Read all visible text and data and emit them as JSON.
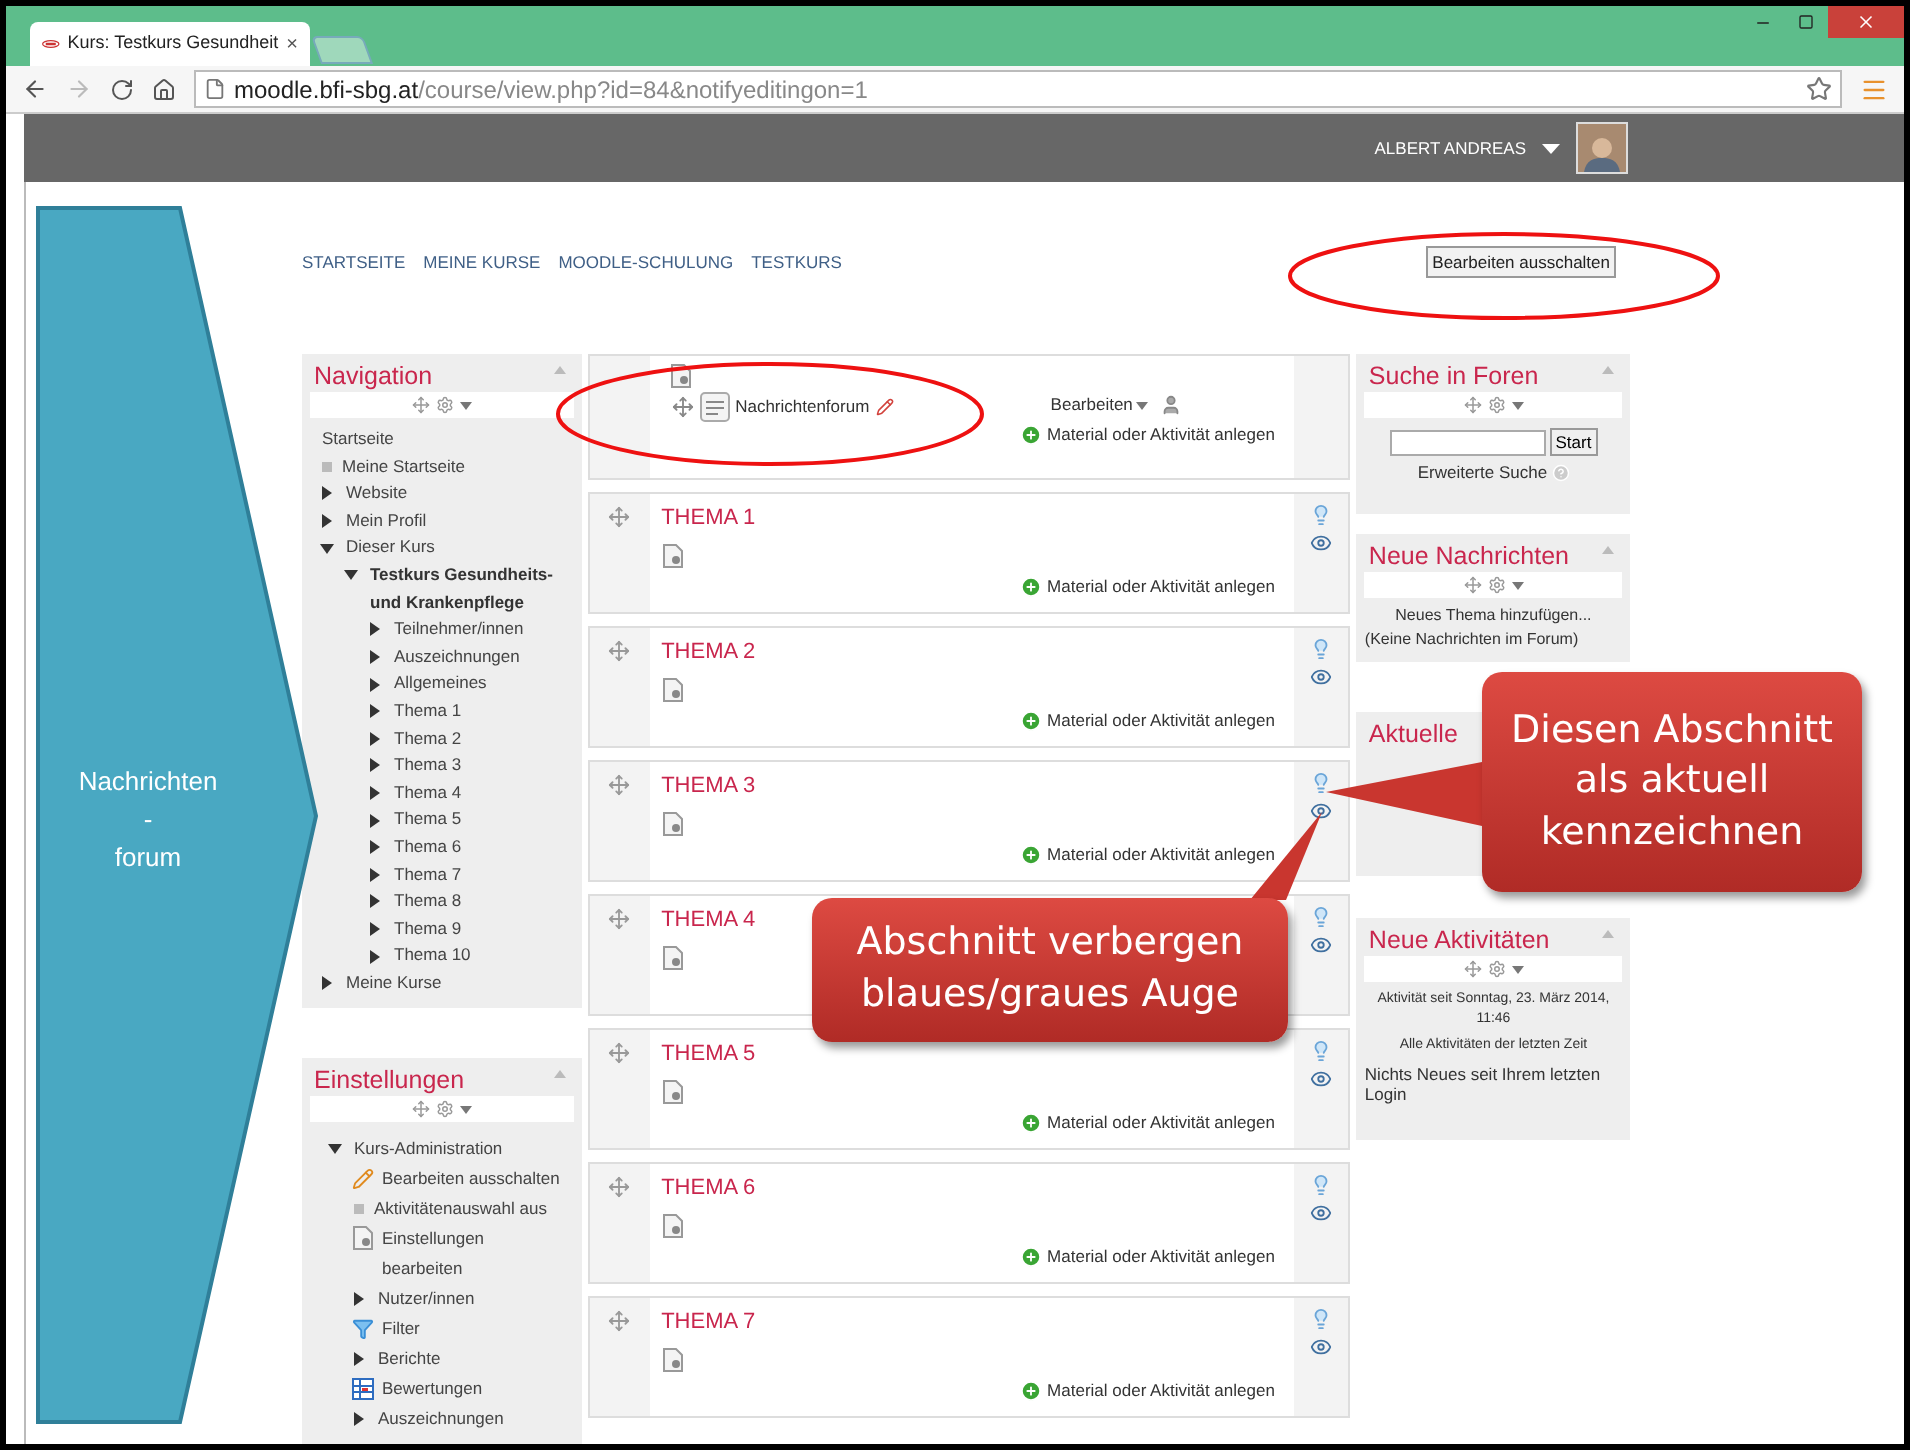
{
  "browser": {
    "tab_title": "Kurs: Testkurs Gesundheit",
    "tab_close": "×",
    "url_host": "moodle.bfi-sbg.at",
    "url_path": "/course/view.php?id=84&notifyeditingon=1"
  },
  "header": {
    "user_name": "ALBERT ANDREAS"
  },
  "breadcrumbs": [
    "STARTSEITE",
    "MEINE KURSE",
    "MOODLE-SCHULUNG",
    "TESTKURS"
  ],
  "edit_button": "Bearbeiten ausschalten",
  "navigation": {
    "title": "Navigation",
    "items": [
      {
        "label": "Startseite",
        "kind": "heading"
      },
      {
        "label": "Meine Startseite",
        "kind": "leaf"
      },
      {
        "label": "Website",
        "kind": "branch",
        "expanded": false
      },
      {
        "label": "Mein Profil",
        "kind": "branch",
        "expanded": false
      },
      {
        "label": "Dieser Kurs",
        "kind": "branch",
        "expanded": true,
        "children": [
          {
            "label": "Testkurs Gesundheits- und Krankenpflege",
            "kind": "current_branch",
            "expanded": true,
            "children": [
              {
                "label": "Teilnehmer/innen",
                "kind": "branch",
                "expanded": false
              },
              {
                "label": "Auszeichnungen",
                "kind": "branch",
                "expanded": false
              },
              {
                "label": "Allgemeines",
                "kind": "branch",
                "expanded": false
              },
              {
                "label": "Thema 1",
                "kind": "branch",
                "expanded": false
              },
              {
                "label": "Thema 2",
                "kind": "branch",
                "expanded": false
              },
              {
                "label": "Thema 3",
                "kind": "branch",
                "expanded": false
              },
              {
                "label": "Thema 4",
                "kind": "branch",
                "expanded": false
              },
              {
                "label": "Thema 5",
                "kind": "branch",
                "expanded": false
              },
              {
                "label": "Thema 6",
                "kind": "branch",
                "expanded": false
              },
              {
                "label": "Thema 7",
                "kind": "branch",
                "expanded": false
              },
              {
                "label": "Thema 8",
                "kind": "branch",
                "expanded": false
              },
              {
                "label": "Thema 9",
                "kind": "branch",
                "expanded": false
              },
              {
                "label": "Thema 10",
                "kind": "branch",
                "expanded": false
              }
            ]
          }
        ]
      },
      {
        "label": "Meine Kurse",
        "kind": "branch",
        "expanded": false
      }
    ]
  },
  "settings": {
    "title": "Einstellungen",
    "items": [
      {
        "label": "Kurs-Administration",
        "kind": "branch",
        "expanded": true,
        "children": [
          {
            "label": "Bearbeiten ausschalten",
            "kind": "pencil"
          },
          {
            "label": "Aktivitätenauswahl aus",
            "kind": "leaf"
          },
          {
            "label": "Einstellungen bearbeiten",
            "kind": "doc"
          },
          {
            "label": "Nutzer/innen",
            "kind": "branch",
            "expanded": false
          },
          {
            "label": "Filter",
            "kind": "filter"
          },
          {
            "label": "Berichte",
            "kind": "branch",
            "expanded": false
          },
          {
            "label": "Bewertungen",
            "kind": "grades"
          },
          {
            "label": "Auszeichnungen",
            "kind": "branch",
            "expanded": false
          }
        ]
      }
    ]
  },
  "top_section": {
    "activity": "Nachrichtenforum",
    "edit_menu": "Bearbeiten",
    "add_link": "Material oder Aktivität anlegen"
  },
  "sections": [
    {
      "title": "THEMA 1",
      "add_link": "Material oder Aktivität anlegen"
    },
    {
      "title": "THEMA 2",
      "add_link": "Material oder Aktivität anlegen"
    },
    {
      "title": "THEMA 3",
      "add_link": "Material oder Aktivität anlegen"
    },
    {
      "title": "THEMA 4"
    },
    {
      "title": "THEMA 5",
      "add_link": "Material oder Aktivität anlegen"
    },
    {
      "title": "THEMA 6",
      "add_link": "Material oder Aktivität anlegen"
    },
    {
      "title": "THEMA 7",
      "add_link": "Material oder Aktivität anlegen"
    }
  ],
  "forum_search": {
    "title": "Suche in Foren",
    "button": "Start",
    "advanced": "Erweiterte Suche"
  },
  "news": {
    "title": "Neue Nachrichten",
    "add_topic": "Neues Thema hinzufügen...",
    "empty": "(Keine Nachrichten im Forum)"
  },
  "current": {
    "title": "Aktuelle"
  },
  "recent": {
    "title": "Neue Aktivitäten",
    "since": "Aktivität seit Sonntag, 23. März 2014, 11:46",
    "all_link": "Alle Aktivitäten der letzten Zeit",
    "none": "Nichts Neues seit Ihrem letzten Login"
  },
  "annotations": {
    "arrow_label": [
      "Nachrichten",
      "-",
      "forum"
    ],
    "callouts": [
      {
        "text": "Diesen Abschnitt als aktuell kennzeichnen"
      },
      {
        "text": "Abschnitt verbergen blaues/graues Auge"
      }
    ]
  }
}
